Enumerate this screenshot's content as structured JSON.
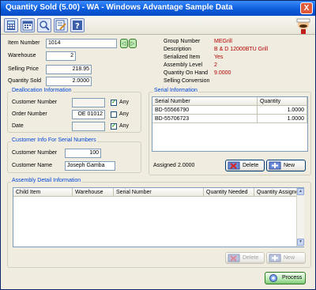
{
  "window": {
    "title": "Quantity Sold (5.00) - WA - Windows Advantage Sample Data",
    "close_glyph": "X"
  },
  "toolbar": {
    "icons": [
      "calculator-icon",
      "calendar-icon",
      "search-icon",
      "edit-notes-icon",
      "help-icon"
    ]
  },
  "left": {
    "item_number_label": "Item Number",
    "item_number": "1014",
    "warehouse_label": "Warehouse",
    "warehouse": "2",
    "selling_price_label": "Selling Price",
    "selling_price": "218.95",
    "quantity_sold_label": "Quantity Sold",
    "quantity_sold": "2.0000"
  },
  "right": {
    "group_number_label": "Group Number",
    "group_number": "MEGrill",
    "description_label": "Description",
    "description": "B & D 12000BTU Grill",
    "serialized_label": "Serialized Item",
    "serialized": "Yes",
    "assembly_label": "Assembly Level",
    "assembly": "2",
    "qoh_label": "Quantity On Hand",
    "qoh": "9.0000",
    "conversion_label": "Selling Conversion"
  },
  "dealloc": {
    "title": "Deallocation Information",
    "customer_number_label": "Customer Number",
    "customer_number": "",
    "order_number_label": "Order Number",
    "order_number": "OE 01012",
    "date_label": "Date",
    "date": "",
    "any_label": "Any",
    "any_customer": "✓",
    "any_order": "",
    "any_date": "✓"
  },
  "serial_info": {
    "title": "Serial Information",
    "columns": [
      "Serial Number",
      "Quantity"
    ],
    "rows": [
      {
        "serial": "BD-55566790",
        "qty": "1.0000"
      },
      {
        "serial": "BD-55706723",
        "qty": "1.0000"
      }
    ],
    "assigned_label": "Assigned",
    "assigned": "2.0000",
    "delete_label": "Delete",
    "new_label": "New"
  },
  "cust_info": {
    "title": "Customer Info For Serial Numbers",
    "customer_number_label": "Customer Number",
    "customer_number": "100",
    "customer_name_label": "Customer Name",
    "customer_name": "Joseph Gamba"
  },
  "assembly": {
    "title": "Assembly Detail Information",
    "columns": [
      "Child Item",
      "Warehouse",
      "Serial Number",
      "Quantity Needed",
      "Quantity Assigned"
    ],
    "delete_label": "Delete",
    "new_label": "New"
  },
  "process_label": "Process",
  "nav": {
    "prev": "◁",
    "next": "▷"
  },
  "colors": {
    "value_red": "#b00000",
    "group_title": "#0046d5",
    "title_blue": "#0a5ad9"
  }
}
